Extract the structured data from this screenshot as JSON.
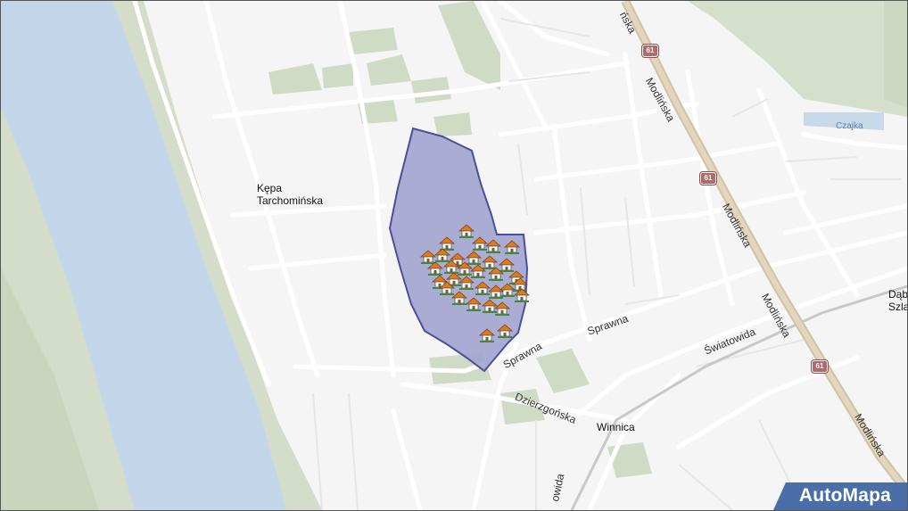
{
  "map": {
    "places": {
      "kepa_line1": "Kępa",
      "kepa_line2": "Tarchomińska",
      "winnica": "Winnica",
      "dab_line1": "Dąb",
      "dab_line2": "Szla"
    },
    "streets": {
      "modlinska_top": "ńska",
      "modlinska_1": "Modlińska",
      "modlinska_2": "Modlińska",
      "modlinska_3": "Modlińska",
      "modlinska_4": "Modlińska",
      "sprawna_1": "Sprawna",
      "sprawna_2": "Sprawna",
      "swiatowida_1": "Światowida",
      "swiatowida_2": "owida",
      "dzierzgonska": "Dzierzgońska"
    },
    "road_number": "61",
    "water_label": "Czajka",
    "brand": "AutoMapa",
    "colors": {
      "river": "#c3d7ea",
      "greenery": "#d2dcc9",
      "area_fill": "#a2a4cf",
      "area_border": "#4c4f9b",
      "main_road": "#d8cbb0",
      "marker_roof": "#e07a1f"
    },
    "markers_icon": "house-icon"
  }
}
